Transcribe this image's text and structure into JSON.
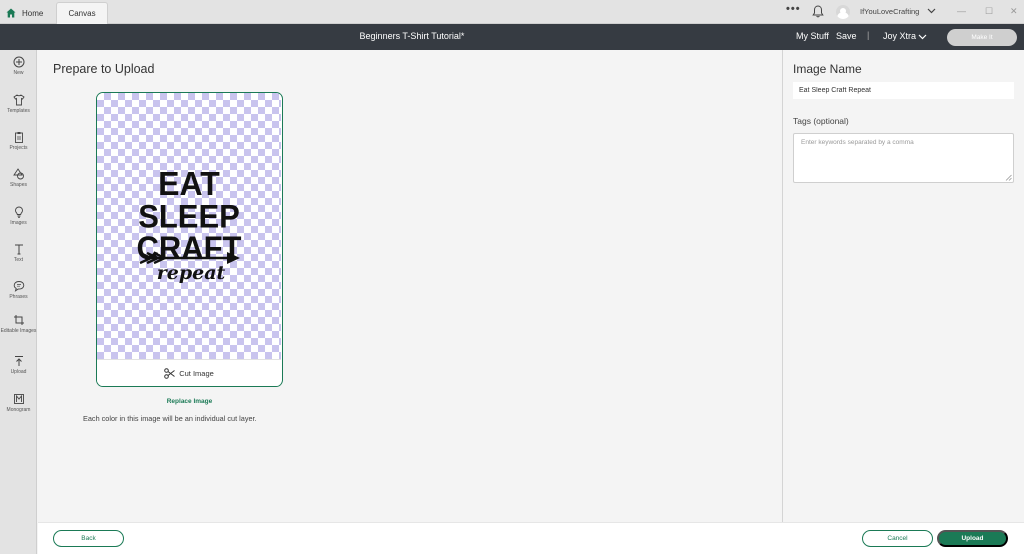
{
  "tabs": {
    "home": "Home",
    "canvas": "Canvas"
  },
  "topbar": {
    "more": "•••",
    "username": "IfYouLoveCrafting",
    "window_controls": [
      "—",
      "☐",
      "✕"
    ]
  },
  "header": {
    "title": "Beginners T-Shirt Tutorial*",
    "my_stuff": "My Stuff",
    "save": "Save",
    "divider": "|",
    "machine": "Joy Xtra",
    "make_it": "Make It"
  },
  "sidebar": {
    "items": [
      {
        "label": "New",
        "icon": "plus-circle-icon"
      },
      {
        "label": "Templates",
        "icon": "tshirt-icon"
      },
      {
        "label": "Projects",
        "icon": "clipboard-icon"
      },
      {
        "label": "Shapes",
        "icon": "shapes-icon"
      },
      {
        "label": "Images",
        "icon": "lightbulb-icon"
      },
      {
        "label": "Text",
        "icon": "text-icon"
      },
      {
        "label": "Phrases",
        "icon": "speech-bubble-icon"
      },
      {
        "label": "Editable Images",
        "icon": "crop-icon"
      },
      {
        "label": "Upload",
        "icon": "upload-icon"
      },
      {
        "label": "Monogram",
        "icon": "monogram-icon"
      }
    ]
  },
  "main": {
    "title": "Prepare to Upload",
    "design_lines": [
      "EAT",
      "SLEEP",
      "CRAFT",
      "repeat"
    ],
    "cut_label": "Cut Image",
    "replace": "Replace Image",
    "info": "Each color in this image will be an individual cut layer."
  },
  "right_panel": {
    "image_name_label": "Image Name",
    "image_name_value": "Eat Sleep Craft Repeat",
    "tags_label": "Tags (optional)",
    "tags_placeholder": "Enter keywords separated by a comma"
  },
  "footer": {
    "back": "Back",
    "cancel": "Cancel",
    "upload": "Upload"
  },
  "colors": {
    "accent": "#1b7a56",
    "header": "#363b42",
    "checker": "#c9c4ee"
  }
}
